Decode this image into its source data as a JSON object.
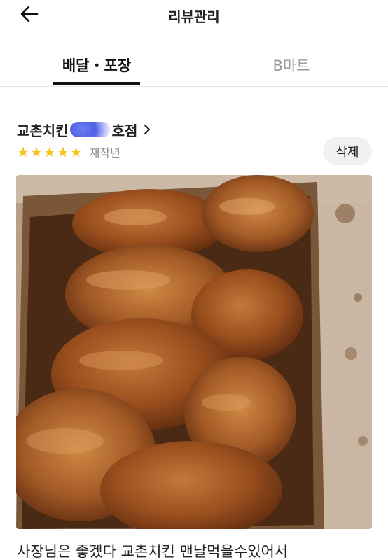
{
  "header": {
    "title": "리뷰관리",
    "back_icon": "arrow-left-icon"
  },
  "tabs": [
    {
      "label": "배달・포장",
      "active": true
    },
    {
      "label": "B마트",
      "active": false
    }
  ],
  "review": {
    "store_name_prefix": "교촌치킨",
    "store_name_suffix": "호점",
    "rating": 5,
    "stars": [
      "★",
      "★",
      "★",
      "★",
      "★"
    ],
    "reorder_label": "재작년",
    "delete_label": "삭제",
    "photo_icon": "fried-chicken-photo",
    "text": "사장님은 좋겠다 교촌치킨 맨날먹을수있어서"
  },
  "colors": {
    "star": "#f7c31a",
    "inactive_tab": "#9a9a9a",
    "button_bg": "#f1f1f1"
  }
}
